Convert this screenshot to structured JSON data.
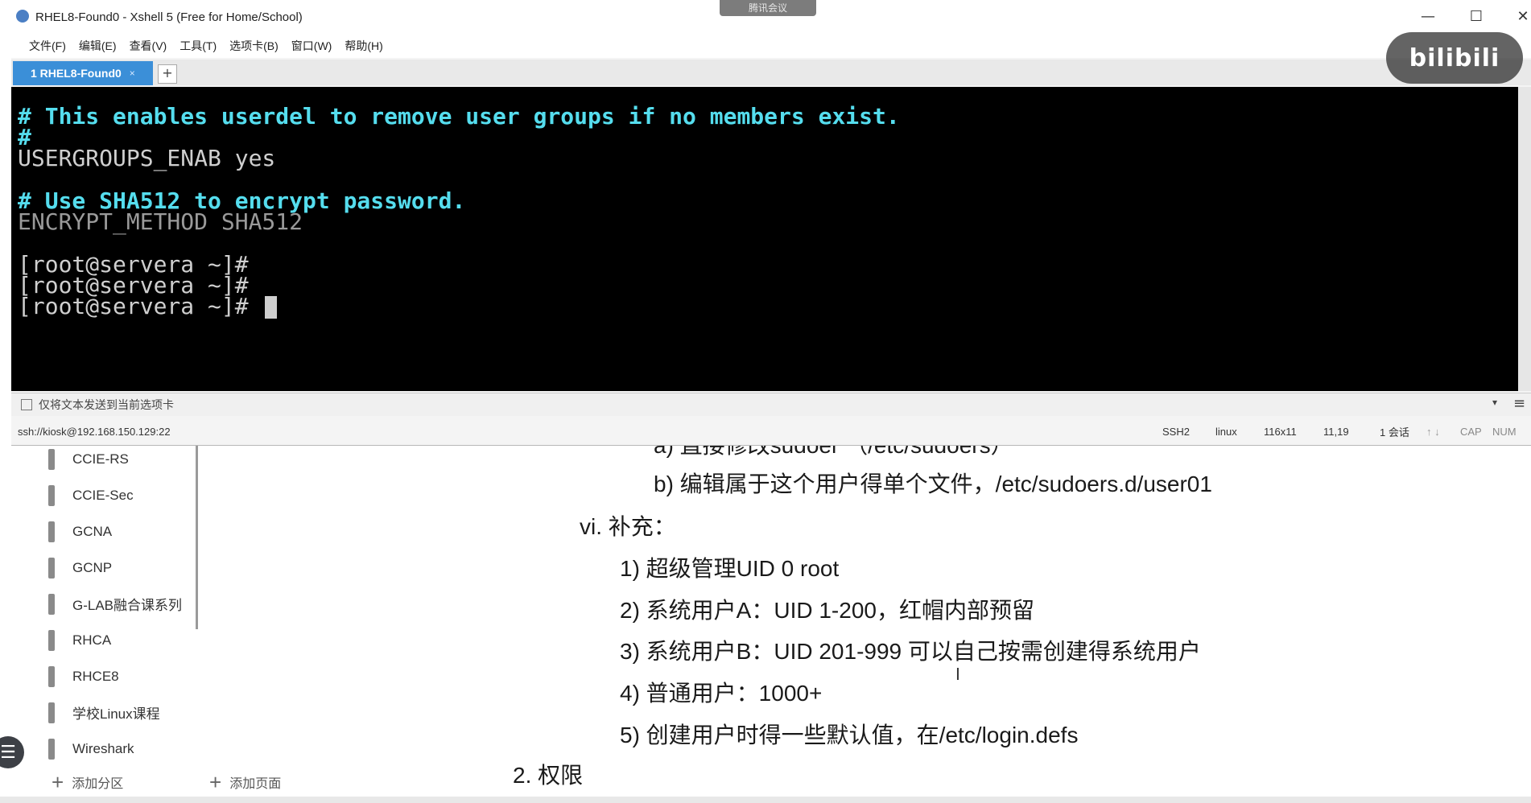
{
  "xshell": {
    "title": "RHEL8-Found0 - Xshell 5 (Free for Home/School)",
    "meeting_tag": "腾讯会议",
    "window_controls": {
      "minimize": "—",
      "maximize": "☐",
      "close": "✕"
    },
    "menu": [
      "文件(F)",
      "编辑(E)",
      "查看(V)",
      "工具(T)",
      "选项卡(B)",
      "窗口(W)",
      "帮助(H)"
    ],
    "tab": {
      "label": "1 RHEL8-Found0",
      "close": "×",
      "add": "+"
    },
    "terminal": {
      "lines": [
        {
          "text": "# This enables userdel to remove user groups if no members exist.",
          "style": "comment"
        },
        {
          "text": "#",
          "style": "comment"
        },
        {
          "text": "USERGROUPS_ENAB yes",
          "style": "plain"
        },
        {
          "text": "",
          "style": "plain"
        },
        {
          "text": "# Use SHA512 to encrypt password.",
          "style": "comment"
        },
        {
          "text": "ENCRYPT_METHOD SHA512",
          "style": "dim"
        },
        {
          "text": "",
          "style": "plain"
        },
        {
          "text": "[root@servera ~]#",
          "style": "plain"
        },
        {
          "text": "[root@servera ~]#",
          "style": "plain"
        },
        {
          "text": "[root@servera ~]# ",
          "style": "plain"
        }
      ]
    },
    "send_bar": {
      "text": "仅将文本发送到当前选项卡",
      "dropdown": "▾",
      "menu": "≡"
    },
    "status": {
      "connection": "ssh://kiosk@192.168.150.129:22",
      "protocol": "SSH2",
      "terminal_type": "linux",
      "size": "116x11",
      "cursor_pos": "11,19",
      "sessions": "1 会话",
      "arrows": "↑ ↓",
      "cap": "CAP",
      "num": "NUM"
    }
  },
  "overlay": {
    "logo_text": "bilibili"
  },
  "notebook": {
    "sections": [
      "CCIE-RS",
      "CCIE-Sec",
      "GCNA",
      "GCNP",
      "G-LAB融合课系列",
      "RHCA",
      "RHCE8",
      "学校Linux课程",
      "Wireshark"
    ],
    "add_section": "添加分区",
    "add_page": "添加页面",
    "nav_icon": "☰"
  },
  "notes": {
    "line_a": "a)  直接修改sudoer （/etc/sudoers）",
    "line_b": "b)  编辑属于这个用户得单个文件，/etc/sudoers.d/user01",
    "line_vi": "vi.  补充：",
    "item1": "1)  超级管理UID 0 root",
    "item2": "2)  系统用户A：UID 1-200，红帽内部预留",
    "item3": "3)  系统用户B：UID 201-999 可以自己按需创建得系统用户",
    "item4": "4)  普通用户：1000+",
    "item5": "5)  创建用户时得一些默认值，在/etc/login.defs",
    "heading2": "2.  权限",
    "cursor": "I"
  }
}
